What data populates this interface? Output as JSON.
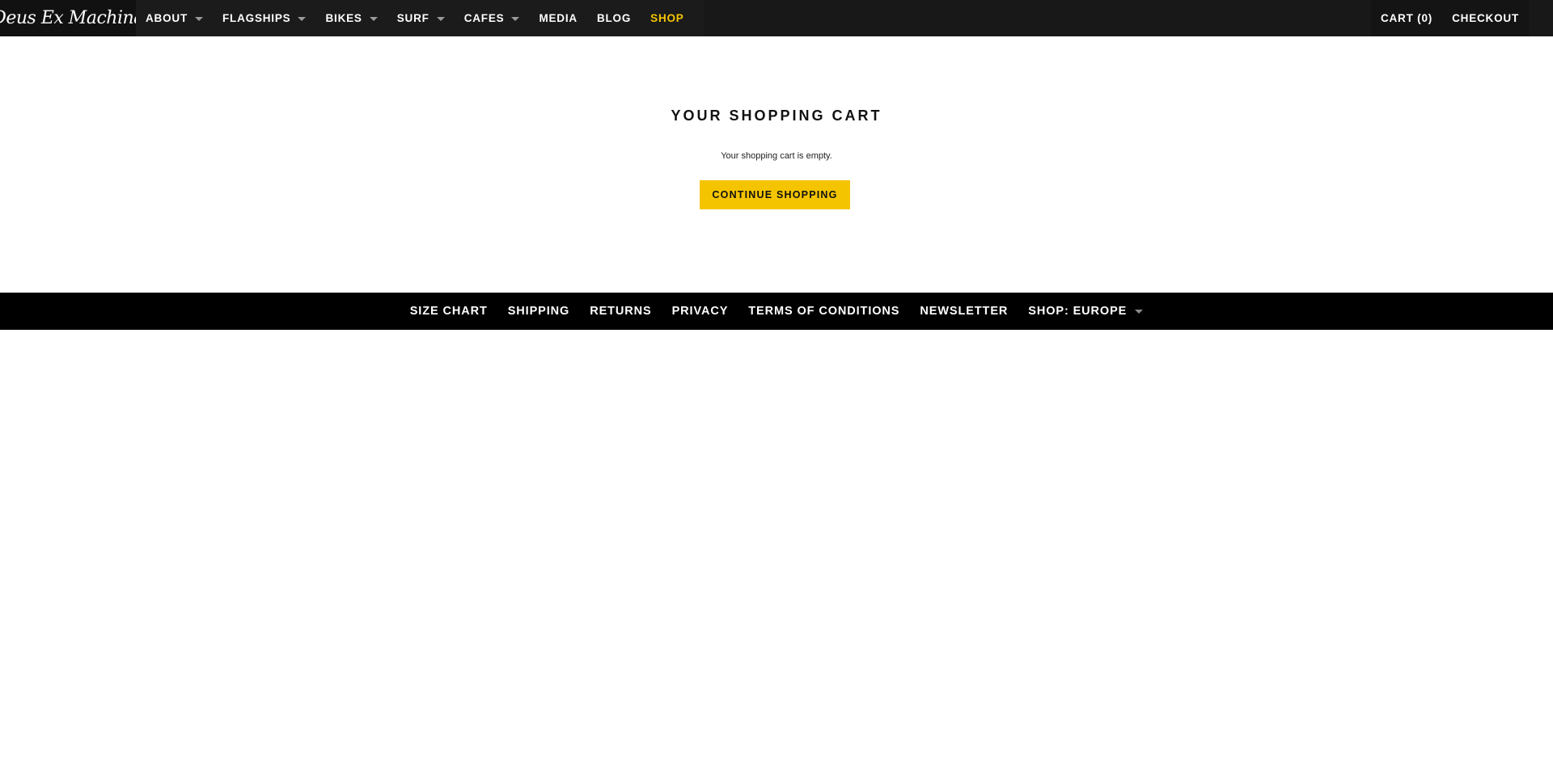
{
  "header": {
    "logo_text": "Deus Ex Machina",
    "nav": [
      {
        "label": "ABOUT",
        "has_dropdown": true
      },
      {
        "label": "FLAGSHIPS",
        "has_dropdown": true
      },
      {
        "label": "BIKES",
        "has_dropdown": true
      },
      {
        "label": "SURF",
        "has_dropdown": true
      },
      {
        "label": "CAFES",
        "has_dropdown": true
      },
      {
        "label": "MEDIA",
        "has_dropdown": false
      },
      {
        "label": "BLOG",
        "has_dropdown": false
      },
      {
        "label": "SHOP",
        "has_dropdown": false,
        "active": true
      }
    ],
    "cart_label": "CART (0)",
    "checkout_label": "CHECKOUT"
  },
  "cart": {
    "title": "YOUR SHOPPING CART",
    "empty_message": "Your shopping cart is empty.",
    "continue_label": "CONTINUE SHOPPING"
  },
  "footer": {
    "links": [
      {
        "label": "SIZE CHART"
      },
      {
        "label": "SHIPPING"
      },
      {
        "label": "RETURNS"
      },
      {
        "label": "PRIVACY"
      },
      {
        "label": "TERMS OF CONDITIONS"
      },
      {
        "label": "NEWSLETTER"
      },
      {
        "label": "SHOP: EUROPE",
        "has_dropdown": true
      }
    ]
  },
  "colors": {
    "accent": "#f5c400",
    "topbar": "#181818",
    "footer": "#000000"
  },
  "icons": {
    "dropdown": "caret-down-icon"
  }
}
